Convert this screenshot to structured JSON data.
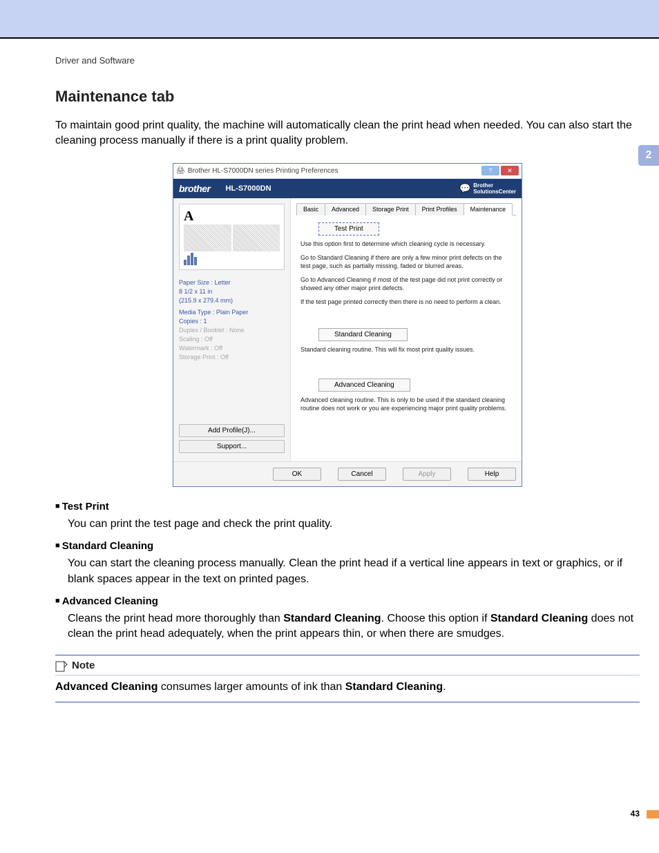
{
  "breadcrumb": "Driver and Software",
  "section_title": "Maintenance tab",
  "chapter_number": "2",
  "page_number": "43",
  "intro": "To maintain good print quality, the machine will automatically clean the print head when needed. You can also start the cleaning process manually if there is a print quality problem.",
  "dialog": {
    "window_title": "Brother HL-S7000DN series Printing Preferences",
    "brand": "brother",
    "model": "HL-S7000DN",
    "solutions_center_line1": "Brother",
    "solutions_center_line2": "SolutionsCenter",
    "left": {
      "paper_size_line1": "Paper Size : Letter",
      "paper_size_line2": "8 1/2 x 11 in",
      "paper_size_line3": "(215.9 x 279.4 mm)",
      "media_type": "Media Type : Plain Paper",
      "copies": "Copies : 1",
      "duplex": "Duplex / Booklet : None",
      "scaling": "Scaling : Off",
      "watermark": "Watermark : Off",
      "storage": "Storage Print : Off",
      "add_profile_btn": "Add Profile(J)...",
      "support_btn": "Support..."
    },
    "tabs": [
      "Basic",
      "Advanced",
      "Storage Print",
      "Print Profiles",
      "Maintenance"
    ],
    "active_tab_index": 4,
    "pane": {
      "test_print_btn": "Test Print",
      "text1": "Use this option first to determine which cleaning cycle is necessary.",
      "text2": "Go to Standard Cleaning if there are only a few minor print defects on the test page, such as partially missing, faded or blurred areas.",
      "text3": "Go to Advanced Cleaning if most of the test page did not print correctly or showed any other major print defects.",
      "text4": "If the test page printed correctly then there is no need to perform a clean.",
      "std_btn": "Standard Cleaning",
      "std_text": "Standard cleaning routine. This will fix most print quality issues.",
      "adv_btn": "Advanced Cleaning",
      "adv_text": "Advanced cleaning routine. This is only to be used if the standard cleaning routine does not work or you are experiencing major print quality problems."
    },
    "footer": {
      "ok": "OK",
      "cancel": "Cancel",
      "apply": "Apply",
      "help": "Help"
    }
  },
  "items": [
    {
      "title": "Test Print",
      "body_html": "You can print the test page and check the print quality."
    },
    {
      "title": "Standard Cleaning",
      "body_html": "You can start the cleaning process manually. Clean the print head if a vertical line appears in text or graphics, or if blank spaces appear in the text on printed pages."
    },
    {
      "title": "Advanced Cleaning",
      "body_html": "Cleans the print head more thoroughly than <b>Standard Cleaning</b>. Choose this option if <b>Standard Cleaning</b> does not clean the print head adequately, when the print appears thin, or when there are smudges."
    }
  ],
  "note": {
    "label": "Note",
    "body_html": "<b>Advanced Cleaning</b> consumes larger amounts of ink than <b>Standard Cleaning</b>."
  }
}
